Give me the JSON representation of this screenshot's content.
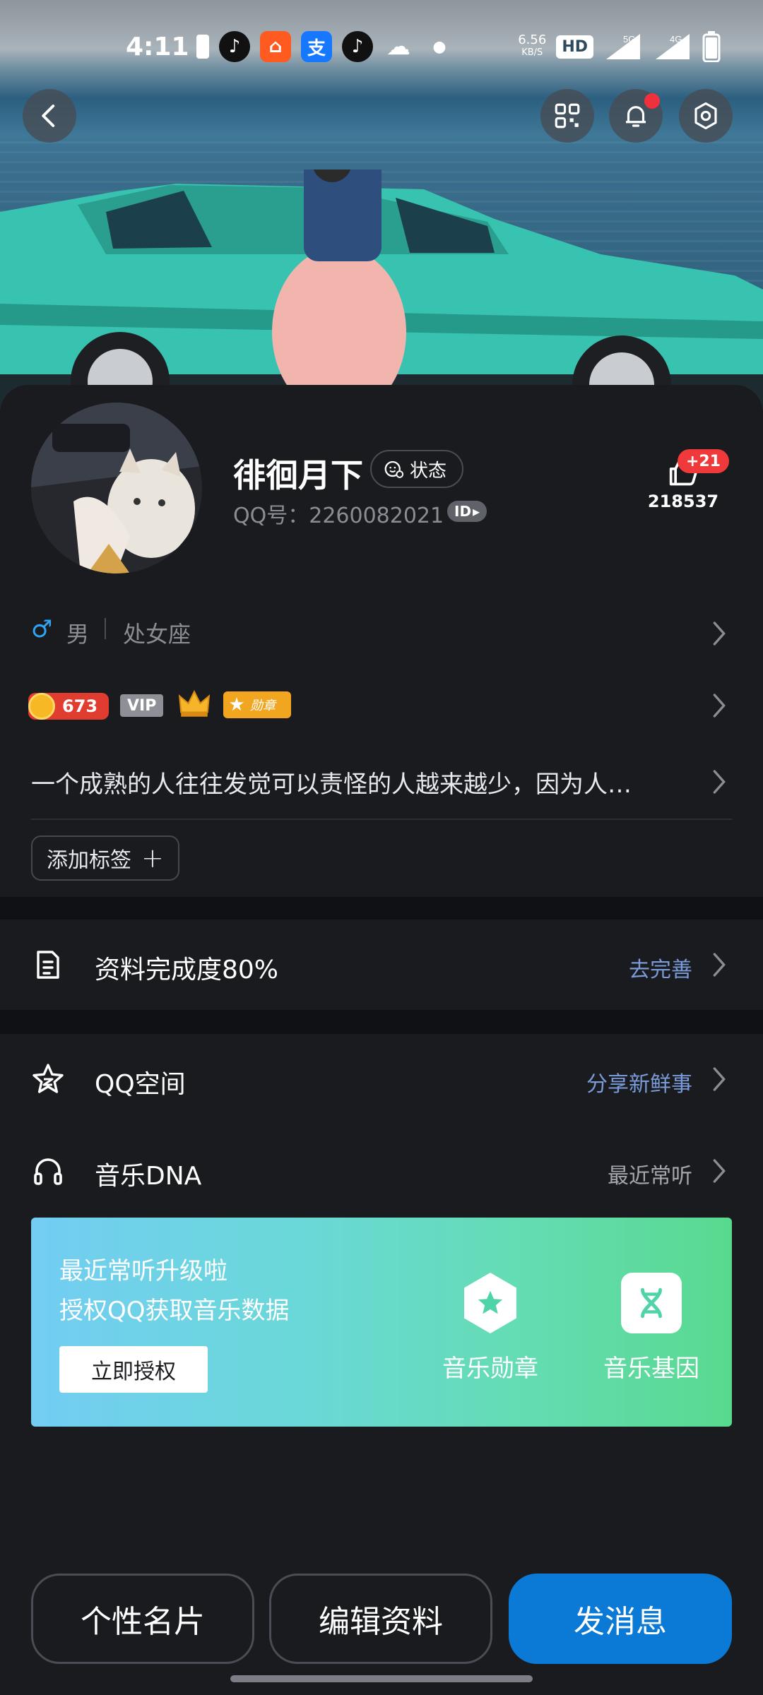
{
  "status_bar": {
    "time": "4:11",
    "net_speed_value": "6.56",
    "net_speed_unit": "KB/S",
    "hd_label": "HD",
    "network_5g": "5G",
    "network_4g": "4G",
    "apps": [
      {
        "name": "tiktok-icon",
        "glyph": "♪",
        "color": "#111111"
      },
      {
        "name": "alibaba-app-icon",
        "glyph": "⌂",
        "color": "#ff5a1f"
      },
      {
        "name": "alipay-icon",
        "glyph": "支",
        "color": "#1677ff"
      },
      {
        "name": "tiktok-icon",
        "glyph": "♪",
        "color": "#111111"
      },
      {
        "name": "wechat-icon",
        "glyph": "☁",
        "color": "#2aae67"
      }
    ]
  },
  "profile": {
    "username": "徘徊月下",
    "status_label": "状态",
    "qq_number": "QQ号：2260082021",
    "id_badge": "ID",
    "likes_count": "218537",
    "likes_delta": "+21",
    "gender": "男",
    "zodiac": "处女座",
    "level_number": "673",
    "vip_label": "VIP",
    "medal_label": "勋章",
    "signature": "一个成熟的人往往发觉可以责怪的人越来越少，因为人…",
    "add_tag_label": "添加标签"
  },
  "completion": {
    "label": "资料完成度80%",
    "action": "去完善"
  },
  "qzone": {
    "label": "QQ空间",
    "action": "分享新鲜事"
  },
  "music": {
    "label": "音乐DNA",
    "action": "最近常听",
    "banner_line1": "最近常听升级啦",
    "banner_line2": "授权QQ获取音乐数据",
    "authorize_label": "立即授权",
    "feature_medal": "音乐勋章",
    "feature_gene": "音乐基因"
  },
  "actions": {
    "card_label": "个性名片",
    "edit_label": "编辑资料",
    "message_label": "发消息"
  },
  "colors": {
    "accent_blue": "#0b7ad6",
    "link_blue": "#7a9bd9",
    "badge_red": "#f0393b",
    "background": "#1a1b1f"
  }
}
